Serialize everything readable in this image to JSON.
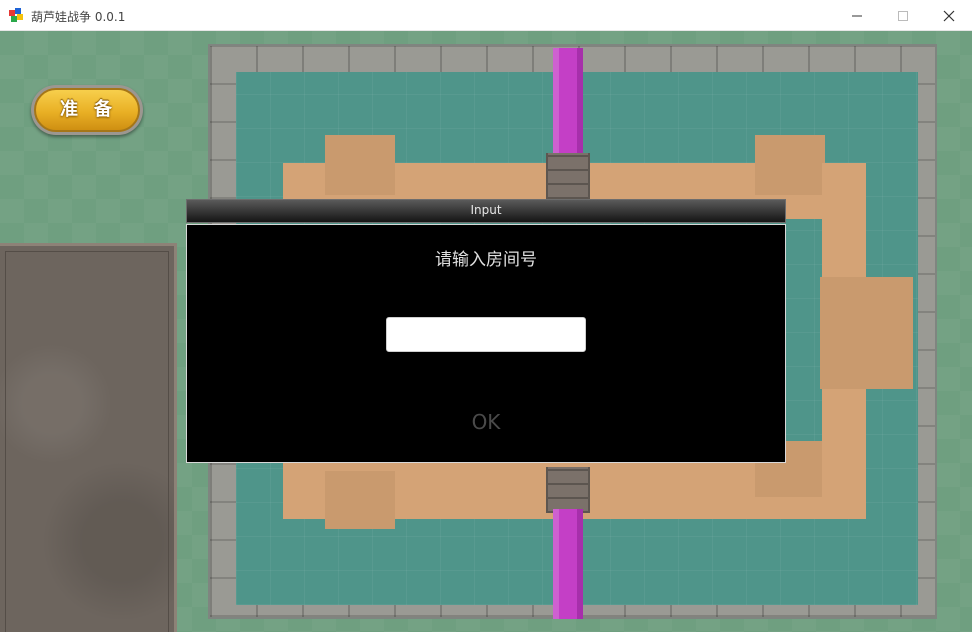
{
  "window": {
    "title": "葫芦娃战争 0.0.1",
    "controls": [
      "minimize-icon",
      "maximize-icon",
      "close-icon"
    ]
  },
  "game": {
    "ready_button_label": "准备"
  },
  "dialog": {
    "title": "Input",
    "prompt": "请输入房间号",
    "input_value": "",
    "input_placeholder": "",
    "ok_label": "OK"
  },
  "colors": {
    "grass": "#6f9f80",
    "water": "#4f958a",
    "sand": "#d4a376",
    "river": "#c43fc6",
    "ready_button": "#e9b025",
    "dialog_background": "#000000"
  }
}
